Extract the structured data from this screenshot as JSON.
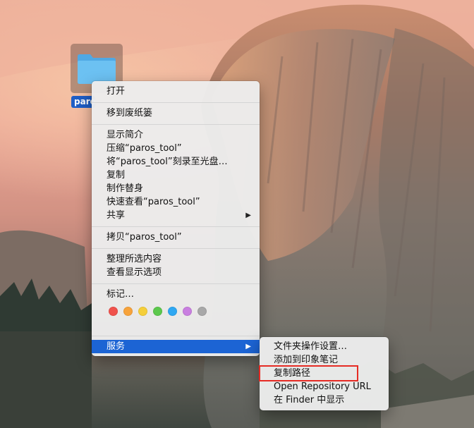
{
  "desktop": {
    "wallpaper": "Yosemite",
    "folder": {
      "label": "paros_tool",
      "visible_label": "paros",
      "icon": "folder-icon",
      "color": "#63b8ee"
    }
  },
  "context_menu": {
    "open": "打开",
    "trash": "移到废纸篓",
    "get_info": "显示简介",
    "compress": "压缩“paros_tool”",
    "burn": "将“paros_tool”刻录至光盘…",
    "duplicate": "复制",
    "make_alias": "制作替身",
    "quick_look": "快速查看“paros_tool”",
    "share": "共享",
    "copy": "拷贝“paros_tool”",
    "clean_up": "整理所选内容",
    "view_options": "查看显示选项",
    "tags_label": "标记…",
    "tag_colors": [
      "#f0524c",
      "#f7a33b",
      "#f5cf3a",
      "#5cc84c",
      "#2fa8f2",
      "#c97fe0",
      "#a8a8a8"
    ],
    "services": "服务",
    "highlighted": "服务"
  },
  "services_submenu": {
    "items": [
      "文件夹操作设置…",
      "添加到印象笔记",
      "复制路径",
      "Open Repository URL",
      "在 Finder 中显示"
    ],
    "annotated_item": "复制路径",
    "annotation_color": "#e62b24"
  },
  "colors": {
    "highlight": "#1c64d4",
    "menu_bg": "#ececec"
  }
}
